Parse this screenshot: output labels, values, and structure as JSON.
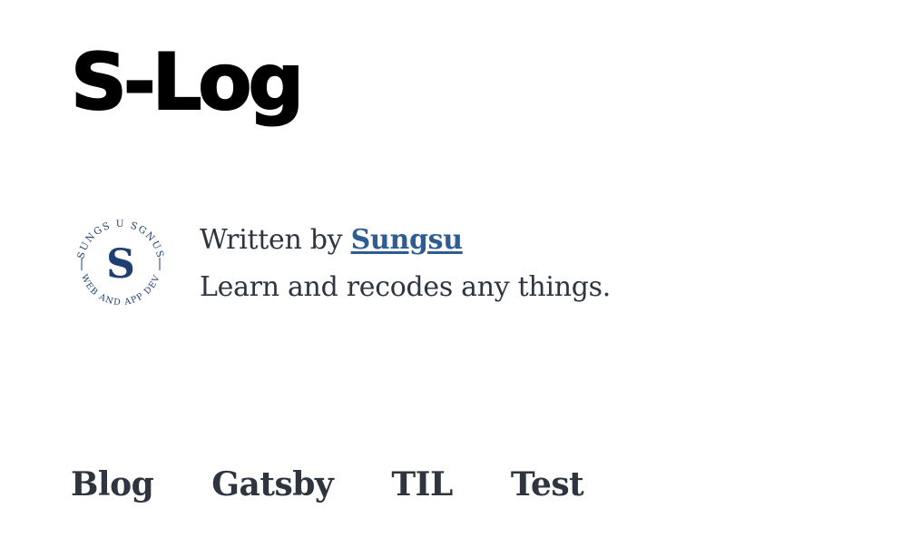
{
  "header": {
    "site_title": "S-Log"
  },
  "bio": {
    "written_by_prefix": "Written by",
    "author_name": "Sungsu",
    "description": "Learn and recodes any things.",
    "avatar": {
      "center_letter": "S",
      "ring_text_top": "SUNGS U SGNUS",
      "ring_text_bottom": "WEB AND APP DEV",
      "color": "#1f3f73"
    }
  },
  "nav": {
    "items": [
      {
        "label": "Blog"
      },
      {
        "label": "Gatsby"
      },
      {
        "label": "TIL"
      },
      {
        "label": "Test"
      }
    ]
  },
  "colors": {
    "title": "#000000",
    "text": "#2e353f",
    "link": "#2f5d93"
  }
}
